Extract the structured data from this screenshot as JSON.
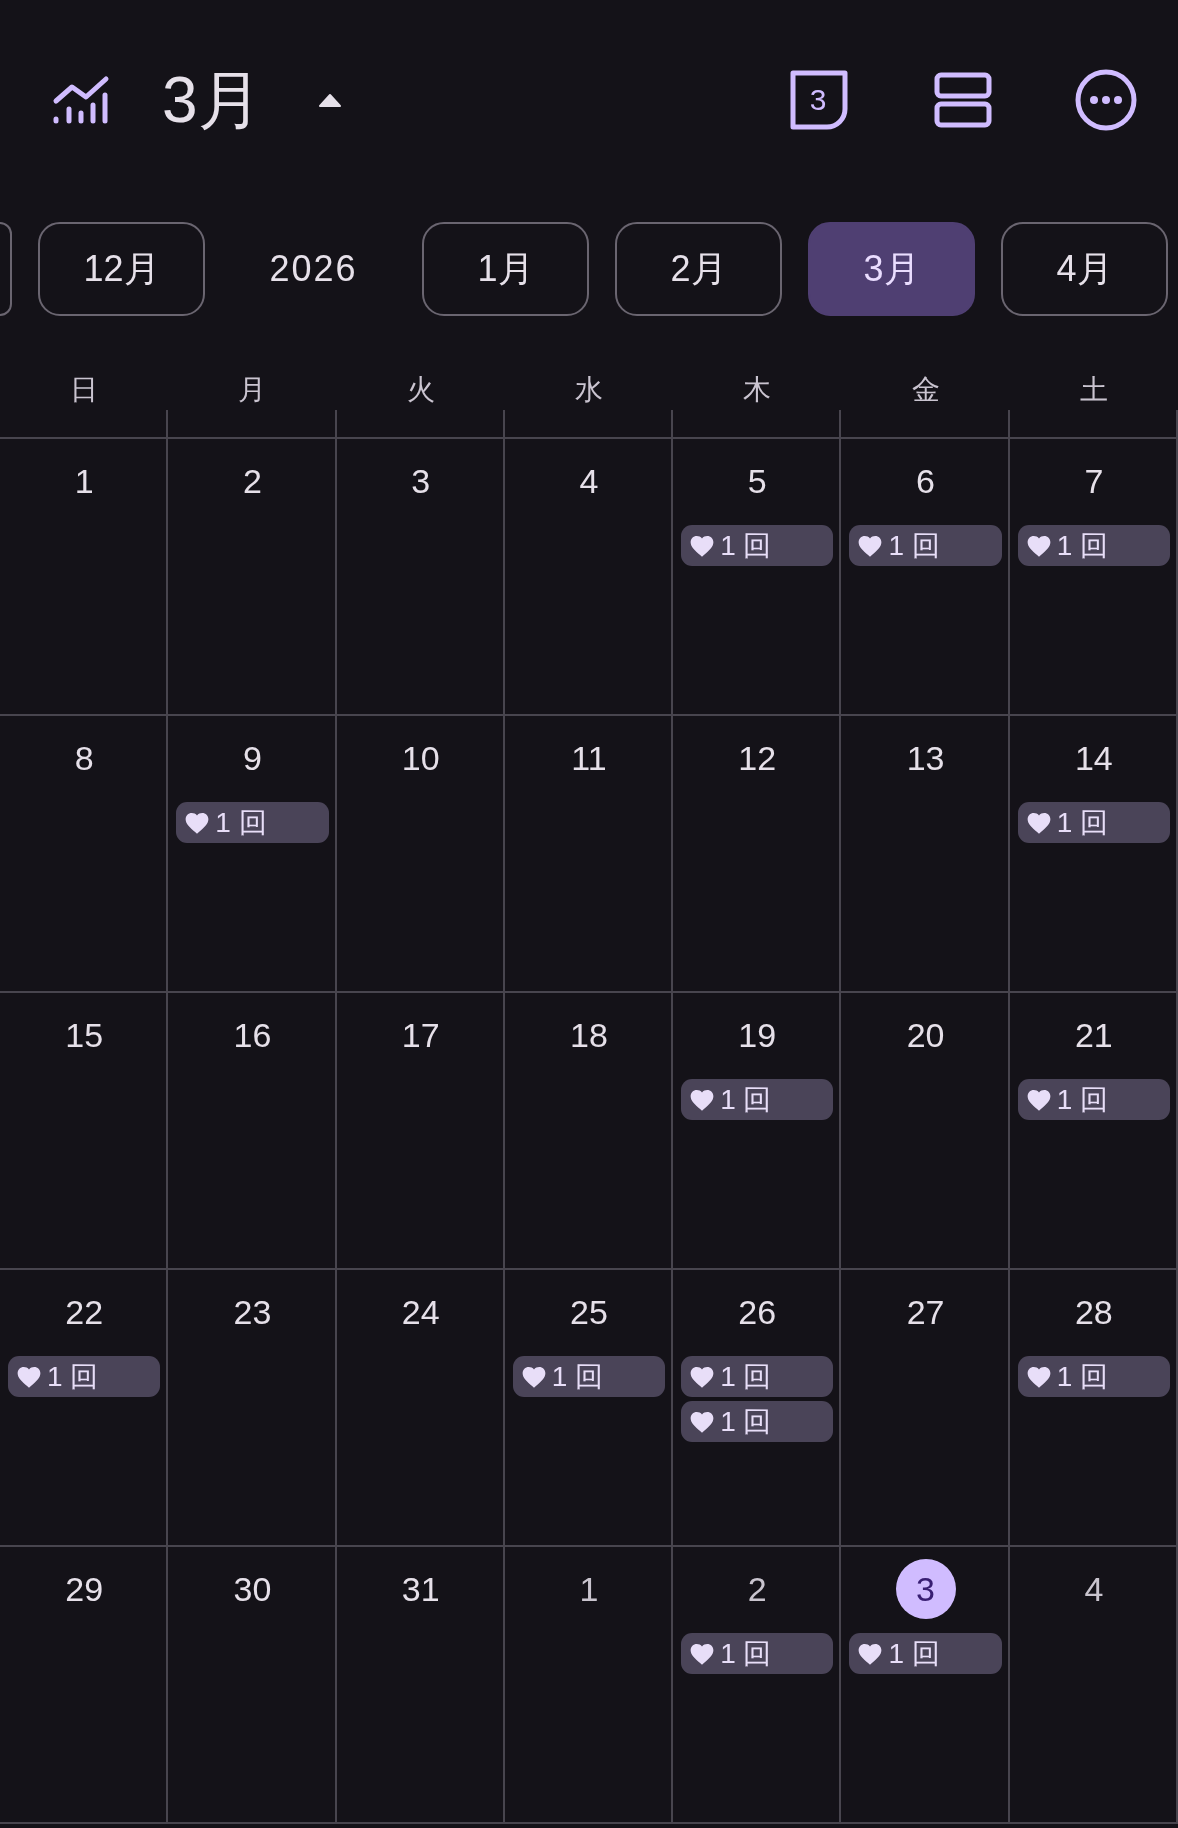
{
  "header": {
    "title": "3月",
    "today_badge": "3"
  },
  "month_strip": [
    {
      "label": "12月",
      "kind": "month",
      "selected": false
    },
    {
      "label": "2026",
      "kind": "year",
      "selected": false
    },
    {
      "label": "1月",
      "kind": "month",
      "selected": false
    },
    {
      "label": "2月",
      "kind": "month",
      "selected": false
    },
    {
      "label": "3月",
      "kind": "month",
      "selected": true
    },
    {
      "label": "4月",
      "kind": "month",
      "selected": false
    }
  ],
  "weekdays": [
    "日",
    "月",
    "火",
    "水",
    "木",
    "金",
    "土"
  ],
  "weeks": [
    [
      {
        "day": "1",
        "outside": false,
        "today": false
      },
      {
        "day": "2",
        "outside": false,
        "today": false
      },
      {
        "day": "3",
        "outside": false,
        "today": false
      },
      {
        "day": "4",
        "outside": false,
        "today": false
      },
      {
        "day": "5",
        "outside": false,
        "today": false,
        "events": [
          "1 回"
        ]
      },
      {
        "day": "6",
        "outside": false,
        "today": false,
        "events": [
          "1 回"
        ]
      },
      {
        "day": "7",
        "outside": false,
        "today": false,
        "events": [
          "1 回"
        ]
      }
    ],
    [
      {
        "day": "8",
        "outside": false,
        "today": false
      },
      {
        "day": "9",
        "outside": false,
        "today": false,
        "events": [
          "1 回"
        ]
      },
      {
        "day": "10",
        "outside": false,
        "today": false
      },
      {
        "day": "11",
        "outside": false,
        "today": false
      },
      {
        "day": "12",
        "outside": false,
        "today": false
      },
      {
        "day": "13",
        "outside": false,
        "today": false
      },
      {
        "day": "14",
        "outside": false,
        "today": false,
        "events": [
          "1 回"
        ]
      }
    ],
    [
      {
        "day": "15",
        "outside": false,
        "today": false
      },
      {
        "day": "16",
        "outside": false,
        "today": false
      },
      {
        "day": "17",
        "outside": false,
        "today": false
      },
      {
        "day": "18",
        "outside": false,
        "today": false
      },
      {
        "day": "19",
        "outside": false,
        "today": false,
        "events": [
          "1 回"
        ]
      },
      {
        "day": "20",
        "outside": false,
        "today": false
      },
      {
        "day": "21",
        "outside": false,
        "today": false,
        "events": [
          "1 回"
        ]
      }
    ],
    [
      {
        "day": "22",
        "outside": false,
        "today": false,
        "events": [
          "1 回"
        ]
      },
      {
        "day": "23",
        "outside": false,
        "today": false
      },
      {
        "day": "24",
        "outside": false,
        "today": false
      },
      {
        "day": "25",
        "outside": false,
        "today": false,
        "events": [
          "1 回"
        ]
      },
      {
        "day": "26",
        "outside": false,
        "today": false,
        "events": [
          "1 回",
          "1 回"
        ]
      },
      {
        "day": "27",
        "outside": false,
        "today": false
      },
      {
        "day": "28",
        "outside": false,
        "today": false,
        "events": [
          "1 回"
        ]
      }
    ],
    [
      {
        "day": "29",
        "outside": false,
        "today": false
      },
      {
        "day": "30",
        "outside": false,
        "today": false
      },
      {
        "day": "31",
        "outside": false,
        "today": false
      },
      {
        "day": "1",
        "outside": true,
        "today": false
      },
      {
        "day": "2",
        "outside": true,
        "today": false,
        "events": [
          "1 回"
        ]
      },
      {
        "day": "3",
        "outside": true,
        "today": true,
        "events": [
          "1 回"
        ]
      },
      {
        "day": "4",
        "outside": true,
        "today": false
      }
    ]
  ]
}
